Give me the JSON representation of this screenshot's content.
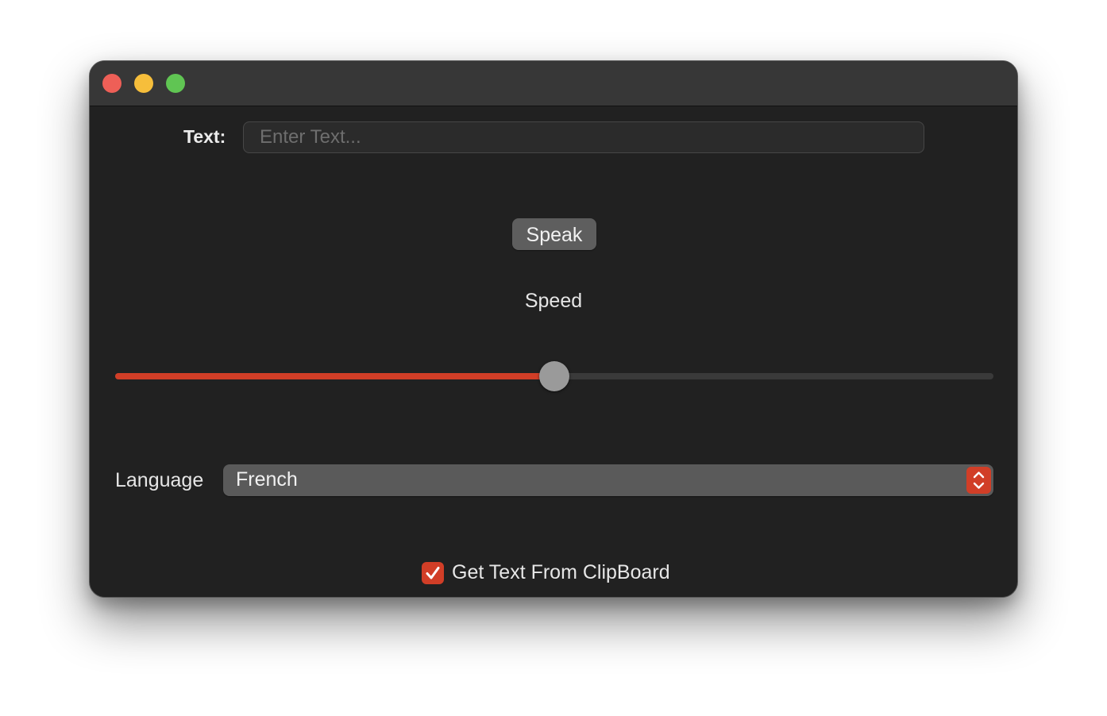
{
  "form": {
    "text_label": "Text:",
    "text_placeholder": "Enter Text...",
    "text_value": ""
  },
  "speak_button": {
    "label": "Speak"
  },
  "speed": {
    "label": "Speed",
    "value_fraction": 0.5
  },
  "language": {
    "label": "Language",
    "selected": "French"
  },
  "clipboard": {
    "label": "Get Text From ClipBoard",
    "checked": true
  },
  "colors": {
    "accent": "#d13e27",
    "window_background": "#212121",
    "titlebar": "#373737"
  }
}
